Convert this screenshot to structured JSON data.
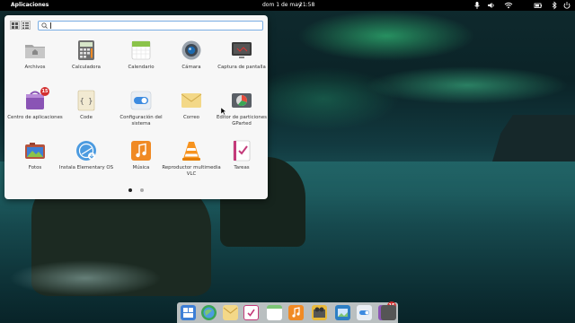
{
  "panel": {
    "applications_label": "Aplicaciones",
    "date": "dom 1 de may",
    "time": "21:58",
    "indicators": [
      "microphone-icon",
      "volume-icon",
      "wifi-icon",
      "battery-icon",
      "bluetooth-icon",
      "power-icon"
    ]
  },
  "launcher": {
    "search_placeholder": "",
    "view_modes": [
      "grid-view",
      "category-view"
    ],
    "apps": [
      {
        "label": "Archivos",
        "icon": "folder-home-icon"
      },
      {
        "label": "Calculadora",
        "icon": "calculator-icon"
      },
      {
        "label": "Calendario",
        "icon": "calendar-icon"
      },
      {
        "label": "Cámara",
        "icon": "camera-icon"
      },
      {
        "label": "Captura de pantalla",
        "icon": "screenshot-icon"
      },
      {
        "label": "Centro de aplicaciones",
        "icon": "appcenter-icon",
        "badge": "15"
      },
      {
        "label": "Code",
        "icon": "code-icon"
      },
      {
        "label": "Configuración del sistema",
        "icon": "system-settings-icon"
      },
      {
        "label": "Correo",
        "icon": "mail-icon"
      },
      {
        "label": "Editor de particiones GParted",
        "icon": "gparted-icon"
      },
      {
        "label": "Fotos",
        "icon": "photos-icon"
      },
      {
        "label": "Instala Elementary OS",
        "icon": "installer-icon"
      },
      {
        "label": "Música",
        "icon": "music-icon"
      },
      {
        "label": "Reproductor multimedia VLC",
        "icon": "vlc-icon"
      },
      {
        "label": "Tareas",
        "icon": "tasks-icon"
      }
    ],
    "pages": 2,
    "current_page": 1
  },
  "dock": {
    "items": [
      {
        "name": "multitasking-view-icon",
        "color": "#3d7fd6"
      },
      {
        "name": "web-browser-icon",
        "color": "#3aa655"
      },
      {
        "name": "mail-icon",
        "color": "#e8c46a"
      },
      {
        "name": "tasks-icon",
        "color": "#c43a7a"
      },
      {
        "name": "calendar-icon",
        "color": "#7cc576"
      },
      {
        "name": "music-icon",
        "color": "#f08a24"
      },
      {
        "name": "videos-icon",
        "color": "#e8b93a"
      },
      {
        "name": "photos-icon",
        "color": "#2d7fc4"
      },
      {
        "name": "system-settings-icon",
        "color": "#4b87c9"
      },
      {
        "name": "appcenter-icon",
        "color": "#8a54b5",
        "badge": "15"
      },
      {
        "name": "screenshot-icon",
        "color": "#555"
      }
    ]
  }
}
